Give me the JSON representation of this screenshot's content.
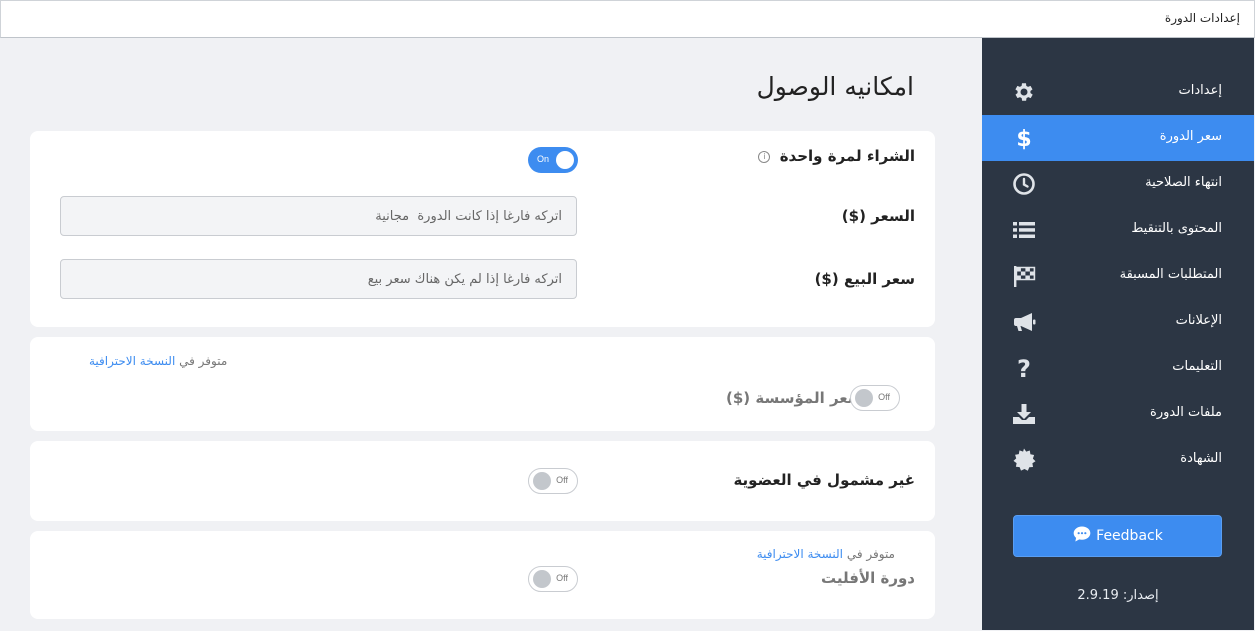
{
  "window": {
    "title": "إعدادات الدورة"
  },
  "page": {
    "title": "امكانيه الوصول"
  },
  "sidebar": {
    "items": [
      {
        "label": "إعدادات",
        "icon": "gear-icon",
        "active": false
      },
      {
        "label": "سعر الدورة",
        "icon": "dollar-icon",
        "active": true
      },
      {
        "label": "انتهاء الصلاحية",
        "icon": "clock-icon",
        "active": false
      },
      {
        "label": "المحتوى بالتنقيط",
        "icon": "list-icon",
        "active": false
      },
      {
        "label": "المتطلبات المسبقة",
        "icon": "checkered-flag-icon",
        "active": false
      },
      {
        "label": "الإعلانات",
        "icon": "megaphone-icon",
        "active": false
      },
      {
        "label": "التعليمات",
        "icon": "question-icon",
        "active": false
      },
      {
        "label": "ملفات الدورة",
        "icon": "download-icon",
        "active": false
      },
      {
        "label": "الشهادة",
        "icon": "certificate-icon",
        "active": false
      }
    ],
    "feedback_label": "Feedback",
    "version": "إصدار: 2.9.19"
  },
  "pricing": {
    "one_time": {
      "label": "الشراء لمرة واحدة",
      "info": "i",
      "toggle": "On",
      "enabled": true
    },
    "price": {
      "label": "السعر ($)",
      "placeholder": "اتركه فارغا إذا كانت الدورة  مجانية",
      "value": ""
    },
    "sale_price": {
      "label": "سعر البيع ($)",
      "placeholder": "اتركه فارغا إذا لم يكن هناك سعر بيع",
      "value": ""
    }
  },
  "enterprise": {
    "pro_prefix": "متوفر في",
    "pro_link": "النسخة الاحترافية",
    "label": "سعر المؤسسة ($)",
    "toggle": "Off",
    "enabled": false
  },
  "membership": {
    "label": "غير مشمول في العضوية",
    "toggle": "Off",
    "enabled": false
  },
  "affiliate": {
    "pro_prefix": "متوفر في",
    "pro_link": "النسخة الاحترافية",
    "label": "دورة الأفليت",
    "toggle": "Off",
    "enabled": false
  },
  "colors": {
    "accent": "#3d8cf0",
    "sidebar_bg": "#2c3644",
    "page_bg": "#f0f1f4"
  }
}
